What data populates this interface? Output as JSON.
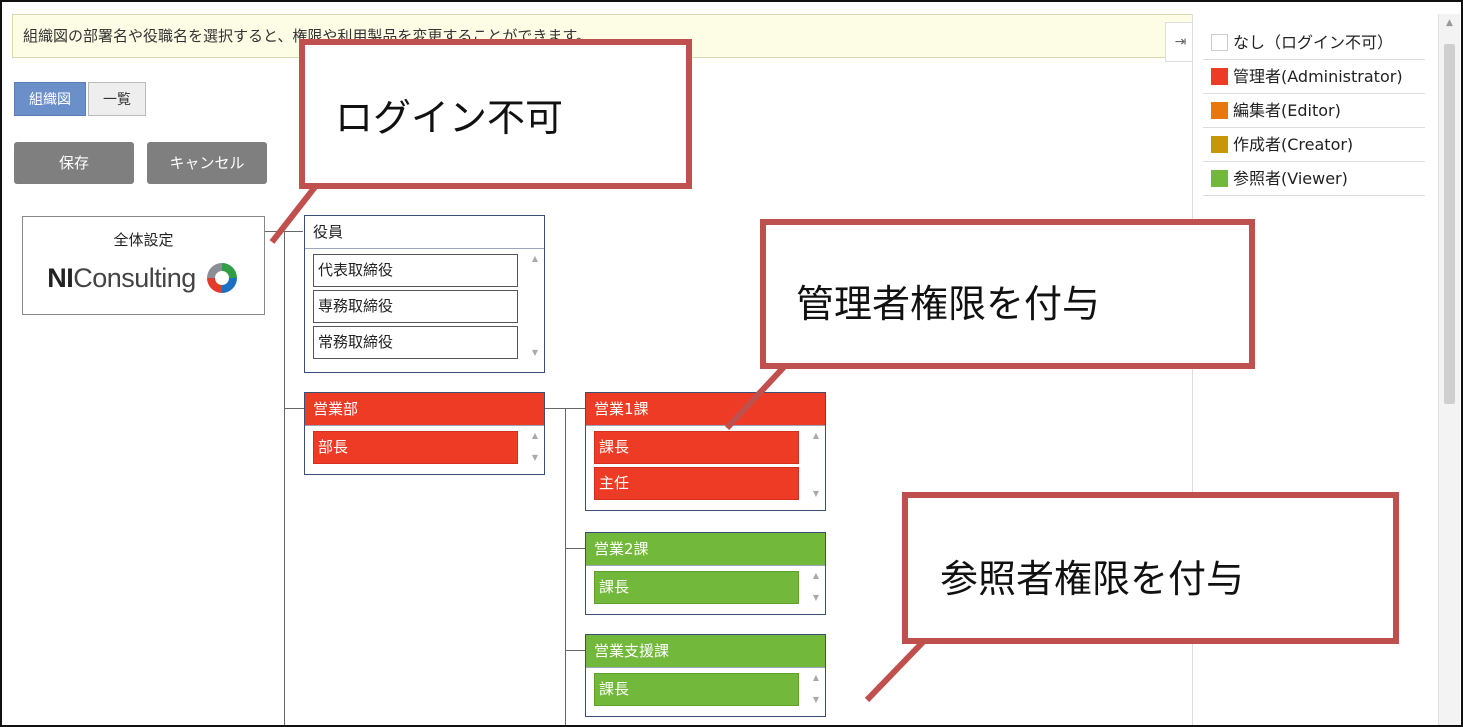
{
  "info_message": "組織図の部署名や役職名を選択すると、権限や利用製品を変更することができます。",
  "tabs": {
    "org_chart": "組織図",
    "list": "一覧"
  },
  "buttons": {
    "save": "保存",
    "cancel": "キャンセル"
  },
  "company": {
    "title": "全体設定",
    "logo_bold": "NI",
    "logo_text": "Consulting"
  },
  "org": {
    "executives": {
      "name": "役員",
      "roles": [
        "代表取締役",
        "専務取締役",
        "常務取締役"
      ]
    },
    "sales_dept": {
      "name": "営業部",
      "roles": [
        "部長"
      ],
      "permission": "Administrator"
    },
    "sales_1": {
      "name": "営業1課",
      "roles": [
        "課長",
        "主任"
      ],
      "permission": "Administrator"
    },
    "sales_2": {
      "name": "営業2課",
      "roles": [
        "課長"
      ],
      "permission": "Viewer"
    },
    "sales_support": {
      "name": "営業支援課",
      "roles": [
        "課長"
      ],
      "permission": "Viewer"
    }
  },
  "legend": [
    {
      "label": "なし（ログイン不可）",
      "color": "#ffffff"
    },
    {
      "label": "管理者(Administrator)",
      "color": "#ee3b25"
    },
    {
      "label": "編集者(Editor)",
      "color": "#e8770e"
    },
    {
      "label": "作成者(Creator)",
      "color": "#c9960a"
    },
    {
      "label": "参照者(Viewer)",
      "color": "#72b83a"
    }
  ],
  "callouts": {
    "no_login": "ログイン不可",
    "admin": "管理者権限を付与",
    "viewer": "参照者権限を付与"
  },
  "colors": {
    "admin": "#ee3b25",
    "viewer": "#72b83a",
    "callout_border": "#c0504d",
    "active_tab": "#6b8fc9"
  }
}
